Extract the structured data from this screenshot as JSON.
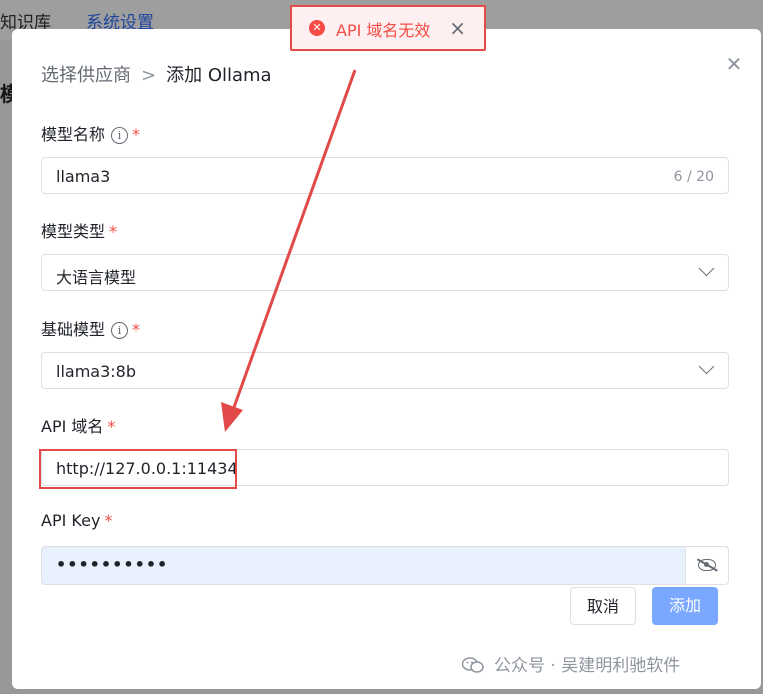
{
  "background": {
    "nav_item_1": "知识库",
    "nav_item_2": "系统设置",
    "side_heading": "模"
  },
  "dialog": {
    "breadcrumb_parent": "选择供应商",
    "breadcrumb_separator": ">",
    "breadcrumb_current": "添加 Ollama",
    "model_name": {
      "label": "模型名称",
      "value": "llama3",
      "counter": "6 / 20"
    },
    "model_type": {
      "label": "模型类型",
      "value": "大语言模型"
    },
    "base_model": {
      "label": "基础模型",
      "value": "llama3:8b"
    },
    "api_domain": {
      "label": "API 域名",
      "value": "http://127.0.0.1:11434"
    },
    "api_key": {
      "label": "API Key",
      "value": "••••••••••"
    },
    "required_mark": "*",
    "cancel_label": "取消",
    "add_label": "添加"
  },
  "toast": {
    "message": "API 域名无效"
  },
  "watermark": {
    "text": "公众号 · 吴建明利驰软件"
  },
  "colors": {
    "primary": "#3370ff",
    "danger": "#f54a45",
    "annotation": "#e24a4a",
    "add_button": "#7aa7ff"
  }
}
